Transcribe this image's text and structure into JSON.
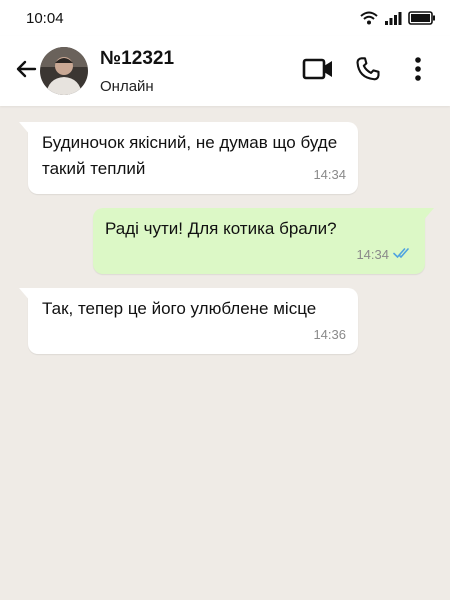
{
  "status_bar": {
    "time": "10:04",
    "icons": [
      "wifi-icon",
      "signal-icon",
      "battery-icon"
    ]
  },
  "header": {
    "back_icon": "arrow-left-icon",
    "contact_name": "№12321",
    "contact_status": "Онлайн",
    "actions": [
      "video-call-icon",
      "phone-icon",
      "more-vert-icon"
    ]
  },
  "messages": [
    {
      "direction": "incoming",
      "text": "Будиночок якісний, не думав що буде такий теплий",
      "time": "14:34"
    },
    {
      "direction": "outgoing",
      "text": "Раді чути! Для котика брали?",
      "time": "14:34",
      "read_receipt": "double-check-icon"
    },
    {
      "direction": "incoming",
      "text": "Так, тепер це його улюблене місце",
      "time": "14:36"
    }
  ],
  "colors": {
    "chat_background": "#efebe6",
    "incoming_bubble": "#ffffff",
    "outgoing_bubble": "#dcf8c6",
    "read_receipt": "#4fa3e0"
  }
}
